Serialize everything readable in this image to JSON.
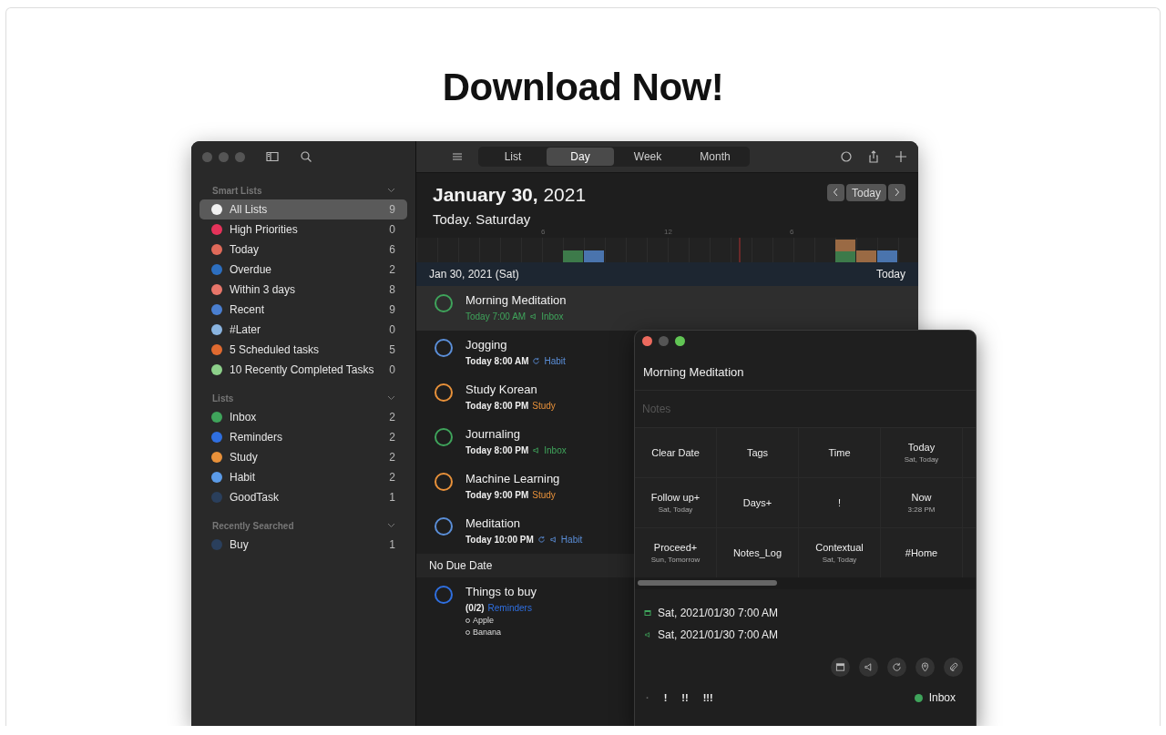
{
  "heading": "Download Now!",
  "toolbar": {
    "view_tabs": [
      {
        "label": "List",
        "selected": false
      },
      {
        "label": "Day",
        "selected": true
      },
      {
        "label": "Week",
        "selected": false
      },
      {
        "label": "Month",
        "selected": false
      }
    ]
  },
  "sidebar": {
    "sections": [
      {
        "title": "Smart Lists",
        "items": [
          {
            "label": "All Lists",
            "count": "9",
            "color": "#f0f0f0",
            "selected": true
          },
          {
            "label": "High Priorities",
            "count": "0",
            "color": "#e5335a",
            "selected": false
          },
          {
            "label": "Today",
            "count": "6",
            "color": "#e06a5a",
            "selected": false
          },
          {
            "label": "Overdue",
            "count": "2",
            "color": "#2d6fc0",
            "selected": false
          },
          {
            "label": "Within 3 days",
            "count": "8",
            "color": "#e8766a",
            "selected": false
          },
          {
            "label": "Recent",
            "count": "9",
            "color": "#4a7fd0",
            "selected": false
          },
          {
            "label": "#Later",
            "count": "0",
            "color": "#8ab4e0",
            "selected": false
          },
          {
            "label": "5 Scheduled tasks",
            "count": "5",
            "color": "#e06a30",
            "selected": false
          },
          {
            "label": "10 Recently Completed Tasks",
            "count": "0",
            "color": "#8dd08a",
            "selected": false
          }
        ]
      },
      {
        "title": "Lists",
        "items": [
          {
            "label": "Inbox",
            "count": "2",
            "color": "#3fa45b",
            "selected": false
          },
          {
            "label": "Reminders",
            "count": "2",
            "color": "#2f6fe0",
            "selected": false
          },
          {
            "label": "Study",
            "count": "2",
            "color": "#e8913a",
            "selected": false
          },
          {
            "label": "Habit",
            "count": "2",
            "color": "#5b9be8",
            "selected": false
          },
          {
            "label": "GoodTask",
            "count": "1",
            "color": "#2a3f5c",
            "selected": false
          }
        ]
      },
      {
        "title": "Recently Searched",
        "items": [
          {
            "label": "Buy",
            "count": "1",
            "color": "#2a3f5c",
            "selected": false
          }
        ]
      }
    ]
  },
  "day_header": {
    "date": "January 30,",
    "year": "2021",
    "subtitle": "Today. Saturday",
    "today_button": "Today"
  },
  "timeline": {
    "ticks": [
      "6",
      "12",
      "6"
    ]
  },
  "groups": [
    {
      "title": "Jan 30, 2021 (Sat)",
      "badge": "Today",
      "tasks": [
        {
          "title": "Morning Meditation",
          "time": "Today 7:00 AM",
          "repeat": false,
          "alert": true,
          "list": "Inbox",
          "color": "#3fa45b",
          "selected": true
        },
        {
          "title": "Jogging",
          "time": "Today 8:00 AM",
          "repeat": true,
          "alert": false,
          "list": "Habit",
          "color": "#5b8fd9",
          "selected": false
        },
        {
          "title": "Study Korean",
          "time": "Today 8:00 PM",
          "repeat": false,
          "alert": false,
          "list": "Study",
          "color": "#e8913a",
          "selected": false
        },
        {
          "title": "Journaling",
          "time": "Today 8:00 PM",
          "repeat": false,
          "alert": true,
          "list": "Inbox",
          "color": "#3fa45b",
          "selected": false
        },
        {
          "title": "Machine Learning",
          "time": "Today 9:00 PM",
          "repeat": false,
          "alert": false,
          "list": "Study",
          "color": "#e8913a",
          "selected": false
        },
        {
          "title": "Meditation",
          "time": "Today 10:00 PM",
          "repeat": true,
          "alert": true,
          "list": "Habit",
          "color": "#5b8fd9",
          "selected": false
        }
      ]
    },
    {
      "title": "No Due Date",
      "tasks": [
        {
          "title": "Things to buy",
          "progress": "(0/2)",
          "repeat": false,
          "alert": false,
          "list": "Reminders",
          "color": "#2f6fe0",
          "selected": false,
          "subitems": [
            "Apple",
            "Banana"
          ]
        }
      ]
    }
  ],
  "detail": {
    "title": "Morning Meditation",
    "notes_placeholder": "Notes",
    "actions": [
      {
        "label": "Clear Date"
      },
      {
        "label": "Tags"
      },
      {
        "label": "Time"
      },
      {
        "label": "Today",
        "sub": "Sat, Today"
      },
      {
        "label": "Follow up+",
        "sub": "Sat, Today"
      },
      {
        "label": "Days+"
      },
      {
        "label": "!"
      },
      {
        "label": "Now",
        "sub": "3:28 PM"
      },
      {
        "label": "Proceed+",
        "sub": "Sun, Tomorrow"
      },
      {
        "label": "Notes_Log"
      },
      {
        "label": "Contextual",
        "sub": "Sat, Today"
      },
      {
        "label": "#Home"
      }
    ],
    "dates": [
      {
        "kind": "start",
        "text": "Sat, 2021/01/30 7:00 AM"
      },
      {
        "kind": "alert",
        "text": "Sat, 2021/01/30 7:00 AM"
      }
    ],
    "priorities": [
      "·",
      "!",
      "!!",
      "!!!"
    ],
    "list": {
      "name": "Inbox",
      "color": "#3fa45b"
    }
  }
}
